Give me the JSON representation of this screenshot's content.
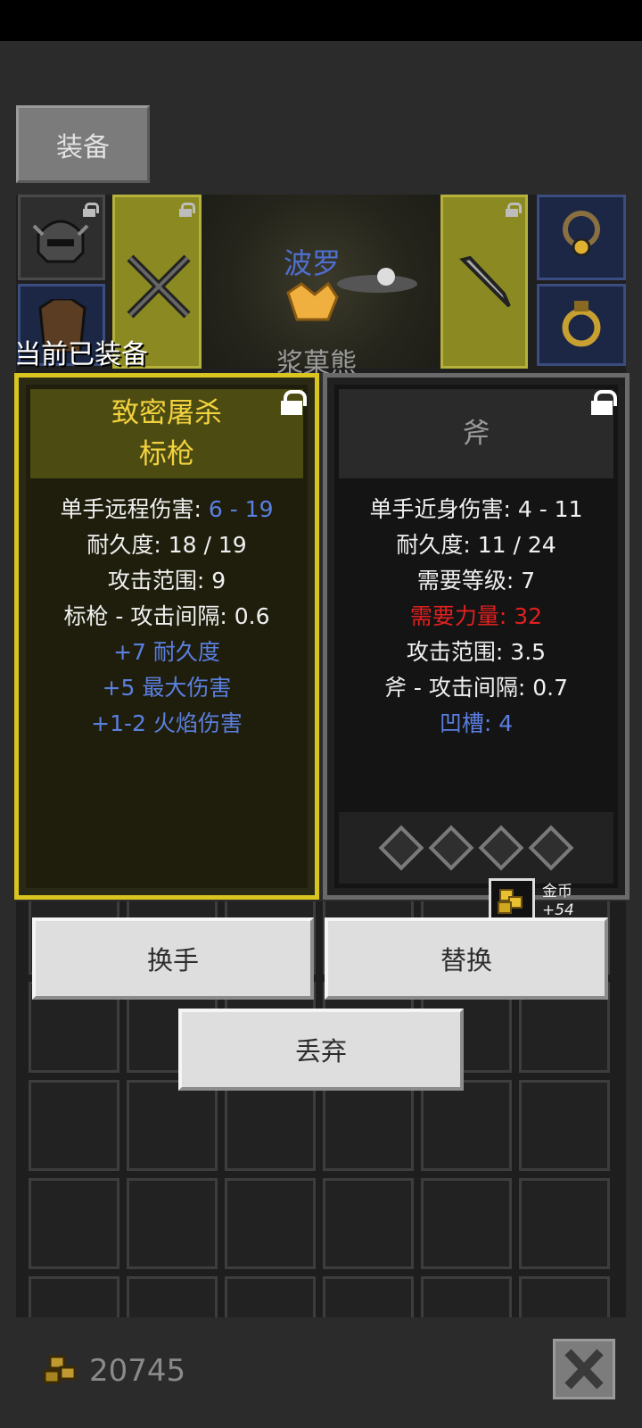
{
  "tab": {
    "label": "装备"
  },
  "hero": {
    "name": "波罗",
    "pet_name": "浆菓熊"
  },
  "equipped_label": "当前已装备",
  "current_item": {
    "title_line1": "致密屠杀",
    "title_line2": "标枪",
    "stats": [
      {
        "label": "单手远程伤害: ",
        "value": "6 - 19"
      },
      {
        "text": "耐久度: 18 / 19"
      },
      {
        "text": "攻击范围: 9"
      },
      {
        "text": "标枪 - 攻击间隔: 0.6"
      },
      {
        "text": "+7 耐久度"
      },
      {
        "text": "+5 最大伤害"
      },
      {
        "text": "+1-2 火焰伤害"
      }
    ]
  },
  "new_item": {
    "title": "斧",
    "stats": [
      {
        "text": "单手近身伤害: 4 - 11"
      },
      {
        "text": "耐久度: 11 / 24"
      },
      {
        "text": "需要等级: 7"
      },
      {
        "text": "需要力量: 32"
      },
      {
        "text": "攻击范围: 3.5"
      },
      {
        "text": "斧 - 攻击间隔: 0.7"
      },
      {
        "text": "凹槽: 4"
      }
    ],
    "socket_count": 4
  },
  "toast": {
    "label": "金币",
    "amount": "+54"
  },
  "buttons": {
    "swap_hand": "换手",
    "replace": "替换",
    "discard": "丢弃"
  },
  "gold": {
    "total": "20745"
  },
  "colors": {
    "accent_gold": "#d9c51f",
    "bonus_blue": "#5b7fe0",
    "requirement_red": "#e02020"
  }
}
